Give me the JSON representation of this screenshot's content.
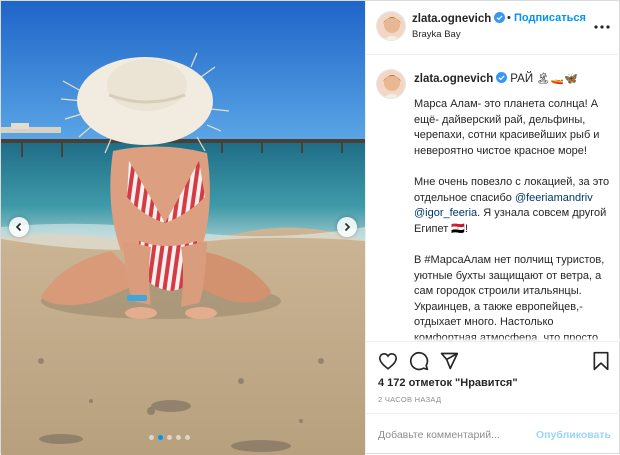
{
  "header": {
    "username": "zlata.ognevich",
    "separator": "•",
    "follow_label": "Подписаться",
    "location": "Brayka Bay"
  },
  "caption": {
    "username": "zlata.ognevich",
    "title": "РАЙ",
    "title_emoji": "🏝🚤🦋",
    "paragraphs": [
      "Марса Алам- это планета солнца! А ещё- дайверский рай, дельфины, черепахи, сотни красивейших рыб и невероятно чистое красное море!",
      "Мне очень повезло с локацией, за это отдельное спасибо",
      "В #МарсаАлам нет полчищ туристов, уютные бухты защищают от ветра, а сам городок строили итальянцы. Украинцев, а также европейцев,- отдыхает много. Настолько комфортная атмосфера, что просто КАЙФ 💙🧖 Любителям"
    ],
    "mention_1": "@feeriamandriv",
    "mention_2": "@igor_feeria",
    "after_mentions": ". Я узнала совсем другой Египет",
    "after_mentions_emoji": "🇪🇬!"
  },
  "stats": {
    "likes_text": "4 172 отметок \"Нравится\"",
    "time_text": "2 ЧАСОВ НАЗАД"
  },
  "comment": {
    "placeholder": "Добавьте комментарий...",
    "publish_label": "Опубликовать"
  },
  "carousel": {
    "slide_count": 5,
    "active_slide": 1
  },
  "icons": [
    "verified-icon",
    "more-icon",
    "heart-icon",
    "comment-icon",
    "share-icon",
    "bookmark-icon",
    "chevron-left-icon",
    "chevron-right-icon"
  ],
  "colors": {
    "accent": "#0095f6",
    "text": "#262626",
    "muted": "#8e8e8e",
    "border": "#efefef"
  }
}
